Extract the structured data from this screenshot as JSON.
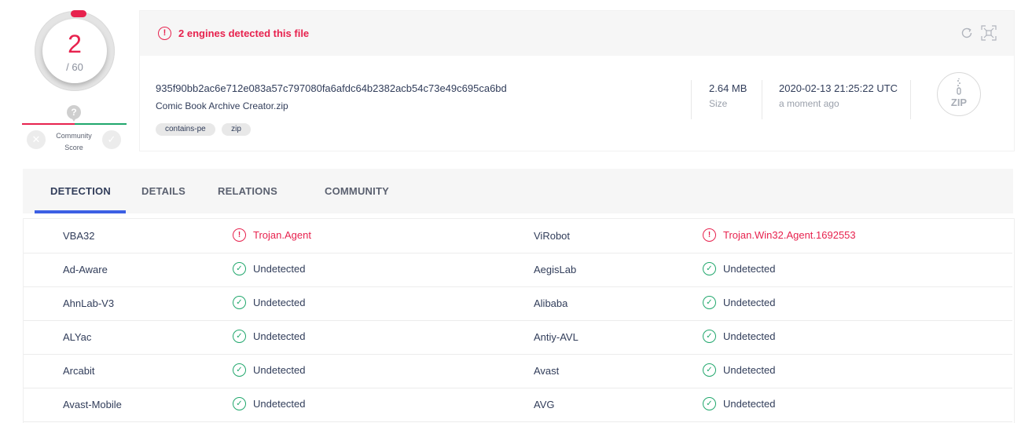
{
  "score": {
    "detected": "2",
    "total": "/ 60"
  },
  "community": {
    "label_line1": "Community",
    "label_line2": "Score",
    "unknown_glyph": "?"
  },
  "header": {
    "alert": "2 engines detected this file",
    "hash": "935f90bb2ac6e712e083a57c797080fa6afdc64b2382acb54c73e49c695ca6bd",
    "filename": "Comic Book Archive Creator.zip",
    "tags": [
      "contains-pe",
      "zip"
    ],
    "size_value": "2.64 MB",
    "size_label": "Size",
    "date_value": "2020-02-13 21:25:22 UTC",
    "date_label": "a moment ago",
    "file_type_icon": "ZIP"
  },
  "tabs": [
    "DETECTION",
    "DETAILS",
    "RELATIONS",
    "COMMUNITY"
  ],
  "detections": [
    {
      "left": {
        "engine": "VBA32",
        "result": "Trojan.Agent",
        "status": "malicious"
      },
      "right": {
        "engine": "ViRobot",
        "result": "Trojan.Win32.Agent.1692553",
        "status": "malicious"
      }
    },
    {
      "left": {
        "engine": "Ad-Aware",
        "result": "Undetected",
        "status": "clean"
      },
      "right": {
        "engine": "AegisLab",
        "result": "Undetected",
        "status": "clean"
      }
    },
    {
      "left": {
        "engine": "AhnLab-V3",
        "result": "Undetected",
        "status": "clean"
      },
      "right": {
        "engine": "Alibaba",
        "result": "Undetected",
        "status": "clean"
      }
    },
    {
      "left": {
        "engine": "ALYac",
        "result": "Undetected",
        "status": "clean"
      },
      "right": {
        "engine": "Antiy-AVL",
        "result": "Undetected",
        "status": "clean"
      }
    },
    {
      "left": {
        "engine": "Arcabit",
        "result": "Undetected",
        "status": "clean"
      },
      "right": {
        "engine": "Avast",
        "result": "Undetected",
        "status": "clean"
      }
    },
    {
      "left": {
        "engine": "Avast-Mobile",
        "result": "Undetected",
        "status": "clean"
      },
      "right": {
        "engine": "AVG",
        "result": "Undetected",
        "status": "clean"
      }
    }
  ],
  "colors": {
    "malicious": "#e7224e",
    "clean": "#20a76c",
    "accent": "#3c5fe4"
  },
  "icons": {
    "alert": "exclamation-circle-icon",
    "refresh": "refresh-icon",
    "expand": "expand-icon",
    "clean": "check-circle-icon",
    "vote_down": "close-icon",
    "vote_up": "check-icon"
  }
}
